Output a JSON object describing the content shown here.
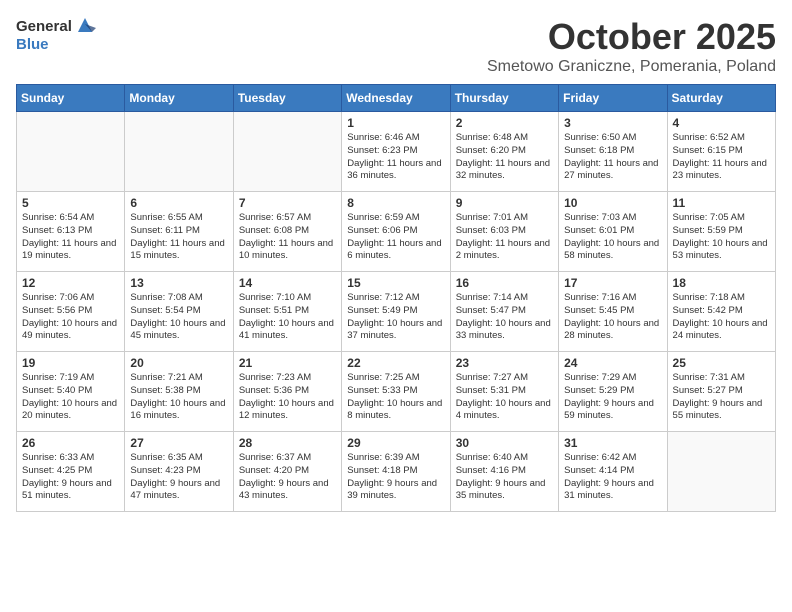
{
  "header": {
    "logo_general": "General",
    "logo_blue": "Blue",
    "month_title": "October 2025",
    "location": "Smetowo Graniczne, Pomerania, Poland"
  },
  "weekdays": [
    "Sunday",
    "Monday",
    "Tuesday",
    "Wednesday",
    "Thursday",
    "Friday",
    "Saturday"
  ],
  "weeks": [
    [
      {
        "day": "",
        "info": ""
      },
      {
        "day": "",
        "info": ""
      },
      {
        "day": "",
        "info": ""
      },
      {
        "day": "1",
        "info": "Sunrise: 6:46 AM\nSunset: 6:23 PM\nDaylight: 11 hours\nand 36 minutes."
      },
      {
        "day": "2",
        "info": "Sunrise: 6:48 AM\nSunset: 6:20 PM\nDaylight: 11 hours\nand 32 minutes."
      },
      {
        "day": "3",
        "info": "Sunrise: 6:50 AM\nSunset: 6:18 PM\nDaylight: 11 hours\nand 27 minutes."
      },
      {
        "day": "4",
        "info": "Sunrise: 6:52 AM\nSunset: 6:15 PM\nDaylight: 11 hours\nand 23 minutes."
      }
    ],
    [
      {
        "day": "5",
        "info": "Sunrise: 6:54 AM\nSunset: 6:13 PM\nDaylight: 11 hours\nand 19 minutes."
      },
      {
        "day": "6",
        "info": "Sunrise: 6:55 AM\nSunset: 6:11 PM\nDaylight: 11 hours\nand 15 minutes."
      },
      {
        "day": "7",
        "info": "Sunrise: 6:57 AM\nSunset: 6:08 PM\nDaylight: 11 hours\nand 10 minutes."
      },
      {
        "day": "8",
        "info": "Sunrise: 6:59 AM\nSunset: 6:06 PM\nDaylight: 11 hours\nand 6 minutes."
      },
      {
        "day": "9",
        "info": "Sunrise: 7:01 AM\nSunset: 6:03 PM\nDaylight: 11 hours\nand 2 minutes."
      },
      {
        "day": "10",
        "info": "Sunrise: 7:03 AM\nSunset: 6:01 PM\nDaylight: 10 hours\nand 58 minutes."
      },
      {
        "day": "11",
        "info": "Sunrise: 7:05 AM\nSunset: 5:59 PM\nDaylight: 10 hours\nand 53 minutes."
      }
    ],
    [
      {
        "day": "12",
        "info": "Sunrise: 7:06 AM\nSunset: 5:56 PM\nDaylight: 10 hours\nand 49 minutes."
      },
      {
        "day": "13",
        "info": "Sunrise: 7:08 AM\nSunset: 5:54 PM\nDaylight: 10 hours\nand 45 minutes."
      },
      {
        "day": "14",
        "info": "Sunrise: 7:10 AM\nSunset: 5:51 PM\nDaylight: 10 hours\nand 41 minutes."
      },
      {
        "day": "15",
        "info": "Sunrise: 7:12 AM\nSunset: 5:49 PM\nDaylight: 10 hours\nand 37 minutes."
      },
      {
        "day": "16",
        "info": "Sunrise: 7:14 AM\nSunset: 5:47 PM\nDaylight: 10 hours\nand 33 minutes."
      },
      {
        "day": "17",
        "info": "Sunrise: 7:16 AM\nSunset: 5:45 PM\nDaylight: 10 hours\nand 28 minutes."
      },
      {
        "day": "18",
        "info": "Sunrise: 7:18 AM\nSunset: 5:42 PM\nDaylight: 10 hours\nand 24 minutes."
      }
    ],
    [
      {
        "day": "19",
        "info": "Sunrise: 7:19 AM\nSunset: 5:40 PM\nDaylight: 10 hours\nand 20 minutes."
      },
      {
        "day": "20",
        "info": "Sunrise: 7:21 AM\nSunset: 5:38 PM\nDaylight: 10 hours\nand 16 minutes."
      },
      {
        "day": "21",
        "info": "Sunrise: 7:23 AM\nSunset: 5:36 PM\nDaylight: 10 hours\nand 12 minutes."
      },
      {
        "day": "22",
        "info": "Sunrise: 7:25 AM\nSunset: 5:33 PM\nDaylight: 10 hours\nand 8 minutes."
      },
      {
        "day": "23",
        "info": "Sunrise: 7:27 AM\nSunset: 5:31 PM\nDaylight: 10 hours\nand 4 minutes."
      },
      {
        "day": "24",
        "info": "Sunrise: 7:29 AM\nSunset: 5:29 PM\nDaylight: 9 hours\nand 59 minutes."
      },
      {
        "day": "25",
        "info": "Sunrise: 7:31 AM\nSunset: 5:27 PM\nDaylight: 9 hours\nand 55 minutes."
      }
    ],
    [
      {
        "day": "26",
        "info": "Sunrise: 6:33 AM\nSunset: 4:25 PM\nDaylight: 9 hours\nand 51 minutes."
      },
      {
        "day": "27",
        "info": "Sunrise: 6:35 AM\nSunset: 4:23 PM\nDaylight: 9 hours\nand 47 minutes."
      },
      {
        "day": "28",
        "info": "Sunrise: 6:37 AM\nSunset: 4:20 PM\nDaylight: 9 hours\nand 43 minutes."
      },
      {
        "day": "29",
        "info": "Sunrise: 6:39 AM\nSunset: 4:18 PM\nDaylight: 9 hours\nand 39 minutes."
      },
      {
        "day": "30",
        "info": "Sunrise: 6:40 AM\nSunset: 4:16 PM\nDaylight: 9 hours\nand 35 minutes."
      },
      {
        "day": "31",
        "info": "Sunrise: 6:42 AM\nSunset: 4:14 PM\nDaylight: 9 hours\nand 31 minutes."
      },
      {
        "day": "",
        "info": ""
      }
    ]
  ]
}
